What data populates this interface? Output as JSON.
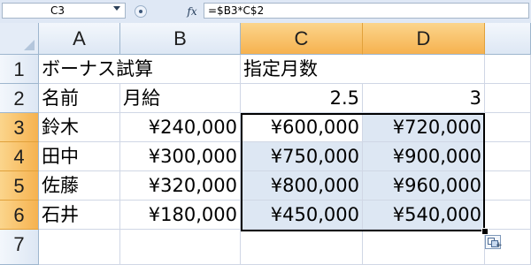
{
  "name_box": {
    "value": "C3"
  },
  "formula_bar": {
    "fx_label": "fx",
    "formula": "=$B3*C$2"
  },
  "columns": [
    "A",
    "B",
    "C",
    "D"
  ],
  "rows": [
    "1",
    "2",
    "3",
    "4",
    "5",
    "6",
    "7"
  ],
  "cells": {
    "A1": "ボーナス試算",
    "C1": "指定月数",
    "A2": "名前",
    "B2": "月給",
    "C2": "2.5",
    "D2": "3",
    "A3": "鈴木",
    "B3": "¥240,000",
    "C3": "¥600,000",
    "D3": "¥720,000",
    "A4": "田中",
    "B4": "¥300,000",
    "C4": "¥750,000",
    "D4": "¥900,000",
    "A5": "佐藤",
    "B5": "¥320,000",
    "C5": "¥800,000",
    "D5": "¥960,000",
    "A6": "石井",
    "B6": "¥180,000",
    "C6": "¥450,000",
    "D6": "¥540,000"
  },
  "selection": {
    "range": "C3:D6",
    "active_cell": "C3"
  },
  "colors": {
    "selected_header": "#f6b24f",
    "range_fill": "#dde7f3",
    "header_fill": "#dde7f4",
    "gridline": "#d0d7e5"
  }
}
